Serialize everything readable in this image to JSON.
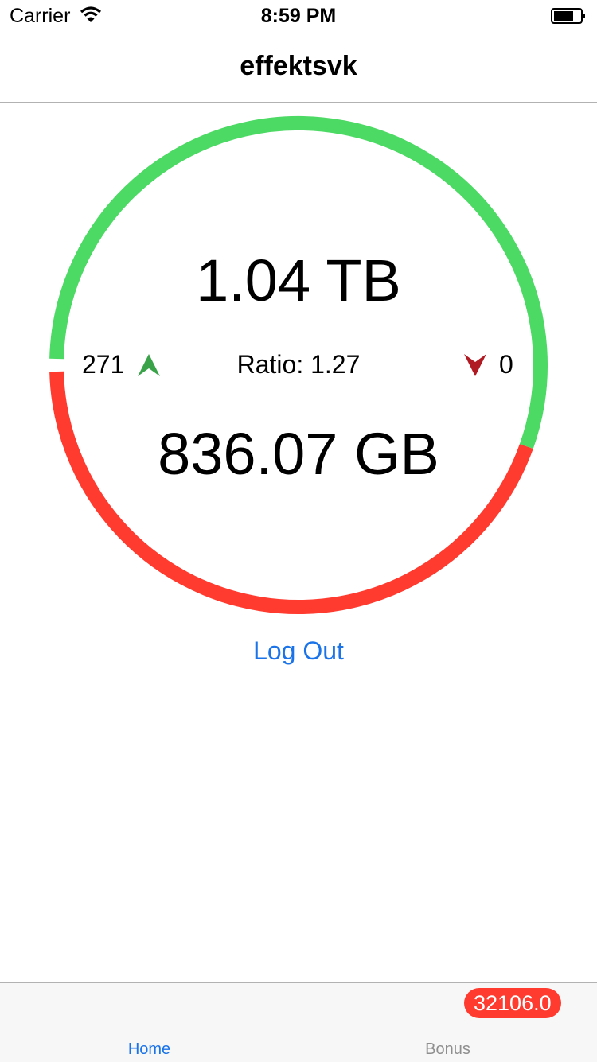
{
  "status_bar": {
    "carrier": "Carrier",
    "time": "8:59 PM"
  },
  "nav": {
    "title": "effektsvk"
  },
  "stats": {
    "uploaded": "1.04 TB",
    "downloaded": "836.07 GB",
    "seeding": "271",
    "ratio": "Ratio: 1.27",
    "leeching": "0",
    "upload_fraction_of_total": 0.555
  },
  "actions": {
    "logout_label": "Log Out"
  },
  "tabs": [
    {
      "label": "Home",
      "selected": true
    },
    {
      "label": "Bonus",
      "badge": "32106.0"
    }
  ],
  "colors": {
    "upload": "#4cd964",
    "download": "#ff3b30",
    "accent": "#1a73e8",
    "badge": "#ff3b30"
  }
}
